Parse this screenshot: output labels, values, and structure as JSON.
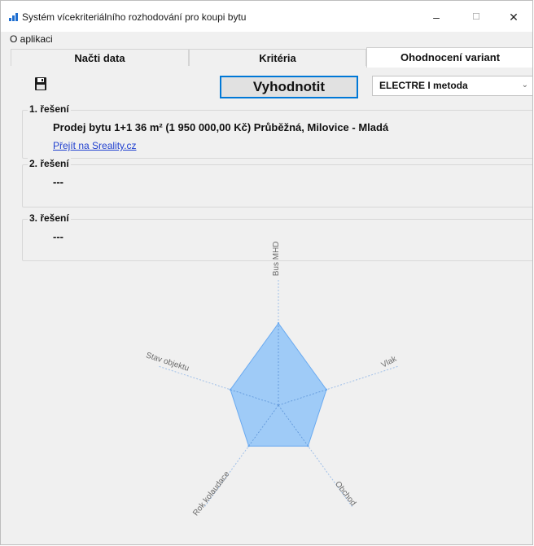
{
  "window": {
    "title": "Systém vícekriteriálního rozhodování pro koupi bytu"
  },
  "menu": {
    "about": "O aplikaci"
  },
  "tabs": [
    {
      "label": "Načti data"
    },
    {
      "label": "Kritéria"
    },
    {
      "label": "Ohodnocení variant"
    }
  ],
  "toolbar": {
    "evaluate_label": "Vyhodnotit",
    "method_selected": "ELECTRE I metoda"
  },
  "solutions": [
    {
      "title": "1. řešení",
      "text": "Prodej bytu 1+1 36 m² (1 950 000,00 Kč) Průběžná, Milovice - Mladá",
      "link": "Přejít na Sreality.cz"
    },
    {
      "title": "2. řešení",
      "text": "---"
    },
    {
      "title": "3. řešení",
      "text": "---"
    }
  ],
  "chart_data": {
    "type": "radar",
    "axes": [
      "Bus MHD",
      "Vlak",
      "Obchod",
      "Rok kolaudace",
      "Stav objektu"
    ],
    "values": [
      0.65,
      0.4,
      0.4,
      0.4,
      0.4
    ],
    "max": 1,
    "grid": false,
    "fill_color": "#90c4f8",
    "stroke_color": "#6aaaf0"
  }
}
